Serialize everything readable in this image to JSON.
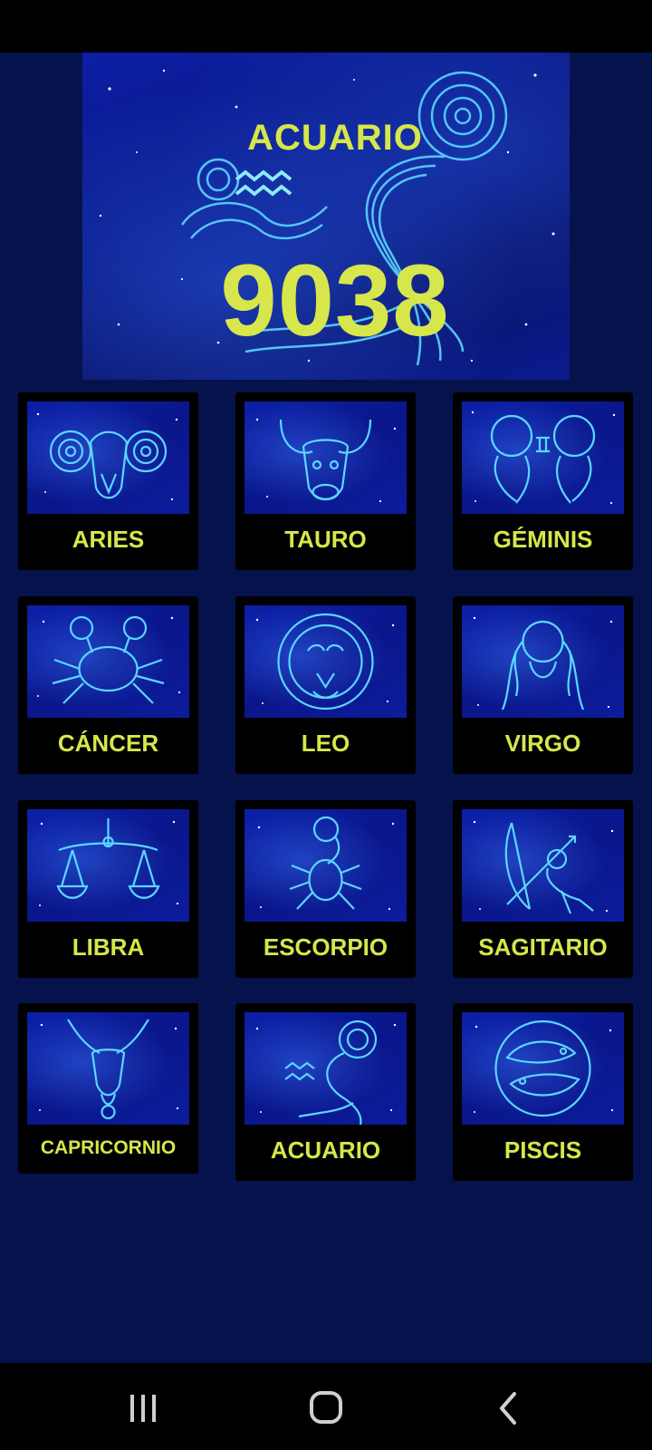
{
  "hero": {
    "sign": "ACUARIO",
    "number": "9038",
    "icon": "aquarius-constellation-art"
  },
  "colors": {
    "background": "#06124c",
    "accent_text": "#d7e64a",
    "card_background": "#000000",
    "art_glow": "#5ad6ff"
  },
  "signs": [
    {
      "label": "ARIES",
      "icon": "ram-icon"
    },
    {
      "label": "TAURO",
      "icon": "bull-icon"
    },
    {
      "label": "GÉMINIS",
      "icon": "twins-icon"
    },
    {
      "label": "CÁNCER",
      "icon": "crab-icon"
    },
    {
      "label": "LEO",
      "icon": "lion-icon"
    },
    {
      "label": "VIRGO",
      "icon": "maiden-icon"
    },
    {
      "label": "LIBRA",
      "icon": "scales-icon"
    },
    {
      "label": "ESCORPIO",
      "icon": "scorpion-icon"
    },
    {
      "label": "SAGITARIO",
      "icon": "archer-icon"
    },
    {
      "label": "CAPRICORNIO",
      "icon": "goat-icon"
    },
    {
      "label": "ACUARIO",
      "icon": "water-bearer-icon"
    },
    {
      "label": "PISCIS",
      "icon": "fish-icon"
    }
  ],
  "nav": {
    "recent": "recent-apps-icon",
    "home": "home-icon",
    "back": "back-icon"
  }
}
